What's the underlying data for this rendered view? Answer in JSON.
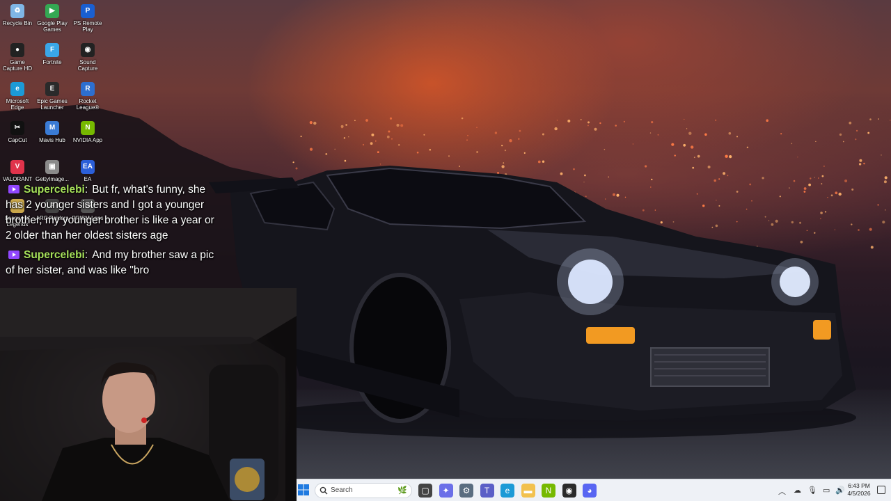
{
  "desktop": {
    "icons": [
      {
        "label": "Recycle Bin",
        "icon": "recycle-bin-icon",
        "color": "#7fb6e6",
        "glyph": "♻"
      },
      {
        "label": "Google Play Games",
        "icon": "google-play-games-icon",
        "color": "#34a853",
        "glyph": "▶"
      },
      {
        "label": "PS Remote Play",
        "icon": "ps-remote-play-icon",
        "color": "#1a5fd1",
        "glyph": "P"
      },
      {
        "label": "Game Capture HD",
        "icon": "game-capture-icon",
        "color": "#222222",
        "glyph": "●"
      },
      {
        "label": "Fortnite",
        "icon": "fortnite-icon",
        "color": "#3aa6e8",
        "glyph": "F"
      },
      {
        "label": "Sound Capture",
        "icon": "sound-capture-icon",
        "color": "#222222",
        "glyph": "◉"
      },
      {
        "label": "Microsoft Edge",
        "icon": "edge-icon",
        "color": "#1c9ad6",
        "glyph": "e"
      },
      {
        "label": "Epic Games Launcher",
        "icon": "epic-games-icon",
        "color": "#2a2a2a",
        "glyph": "E"
      },
      {
        "label": "Rocket League®",
        "icon": "rocket-league-icon",
        "color": "#2d6fd0",
        "glyph": "R"
      },
      {
        "label": "CapCut",
        "icon": "capcut-icon",
        "color": "#111111",
        "glyph": "✂"
      },
      {
        "label": "Mavis Hub",
        "icon": "mavis-hub-icon",
        "color": "#3a7bd5",
        "glyph": "M"
      },
      {
        "label": "NVIDIA App",
        "icon": "nvidia-icon",
        "color": "#76b900",
        "glyph": "N"
      },
      {
        "label": "VALORANT",
        "icon": "valorant-icon",
        "color": "#e0334b",
        "glyph": "V"
      },
      {
        "label": "GettyImage...",
        "icon": "image-file-icon",
        "color": "#8a8a8a",
        "glyph": "▣"
      },
      {
        "label": "EA",
        "icon": "ea-icon",
        "color": "#2b5fd9",
        "glyph": "EA"
      },
      {
        "label": "League of Legends",
        "icon": "league-icon",
        "color": "#c9a64a",
        "glyph": "L"
      },
      {
        "label": "ARC Raiders",
        "icon": "arc-raiders-icon",
        "color": "#444444",
        "glyph": "A"
      },
      {
        "label": "PRISM Lens",
        "icon": "prism-lens-icon",
        "color": "#555555",
        "glyph": "◇"
      }
    ]
  },
  "chat": {
    "messages": [
      {
        "user": "Supercelebi",
        "text": "But fr, what's funny, she has 2 younger sisters and I got a younger brother, my younger brother is like a year or 2 older than her oldest sisters age"
      },
      {
        "user": "Supercelebi",
        "text": "And my brother saw a pic of her sister, and was like \"bro"
      }
    ]
  },
  "taskbar": {
    "search_placeholder": "Search",
    "apps": [
      {
        "name": "task-view",
        "icon": "task-view-icon",
        "color": "#444444",
        "glyph": "▢"
      },
      {
        "name": "copilot",
        "icon": "copilot-icon",
        "color": "#6b6fe8",
        "glyph": "✦"
      },
      {
        "name": "settings",
        "icon": "settings-icon",
        "color": "#5a6d80",
        "glyph": "⚙"
      },
      {
        "name": "teams",
        "icon": "teams-icon",
        "color": "#5b5fc7",
        "glyph": "T"
      },
      {
        "name": "edge",
        "icon": "edge-icon",
        "color": "#1c9ad6",
        "glyph": "e"
      },
      {
        "name": "file-explorer",
        "icon": "folder-icon",
        "color": "#f2c14e",
        "glyph": "▬"
      },
      {
        "name": "nvidia",
        "icon": "nvidia-icon",
        "color": "#76b900",
        "glyph": "N"
      },
      {
        "name": "obs",
        "icon": "obs-icon",
        "color": "#2a2a2a",
        "glyph": "◉"
      },
      {
        "name": "discord",
        "icon": "discord-icon",
        "color": "#5865f2",
        "glyph": "◕"
      }
    ],
    "clock_time": "6:43 PM",
    "clock_date": "4/5/2026"
  }
}
